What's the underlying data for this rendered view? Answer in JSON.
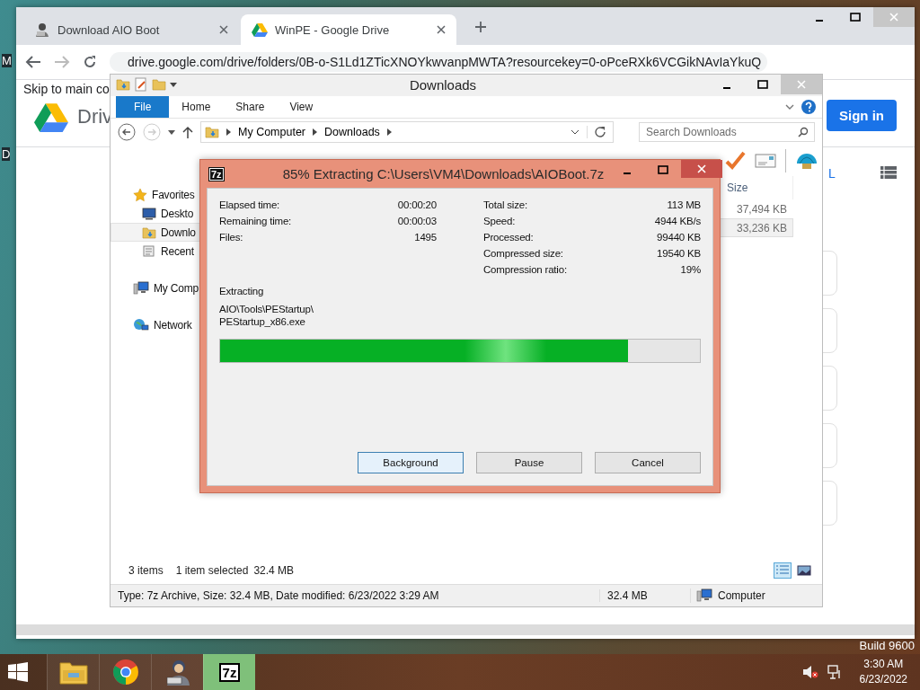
{
  "desktop": {
    "labels": [
      "M",
      "D"
    ],
    "build_label": "Build 9600"
  },
  "browser": {
    "tabs": [
      {
        "title": "Download AIO Boot",
        "kind": "avatar",
        "selected": false
      },
      {
        "title": "WinPE - Google Drive",
        "kind": "drive",
        "selected": true
      }
    ],
    "url": "drive.google.com/drive/folders/0B-o-S1Ld1ZTicXNOYkwvanpMWTA?resourcekey=0-oPceRXk6VCGikNAvIaYkuQ",
    "skip_link": "Skip to main co",
    "app_name": "Driv",
    "sign_in": "Sign in",
    "column_text": "L"
  },
  "explorer": {
    "title": "Downloads",
    "ribbon_tabs": [
      {
        "label": "File",
        "selected": true
      },
      {
        "label": "Home",
        "selected": false
      },
      {
        "label": "Share",
        "selected": false
      },
      {
        "label": "View",
        "selected": false
      }
    ],
    "breadcrumb": [
      "My Computer",
      "Downloads"
    ],
    "search": {
      "placeholder": "Search Downloads"
    },
    "nav": [
      {
        "label": "Favorites",
        "kind": "star",
        "selected": false,
        "children": [
          {
            "label": "Deskto",
            "kind": "desktop",
            "selected": false
          },
          {
            "label": "Downlo",
            "kind": "downloads",
            "selected": true
          },
          {
            "label": "Recent",
            "kind": "recent",
            "selected": false
          }
        ]
      },
      {
        "label": "My Comp",
        "kind": "computer",
        "selected": false
      },
      {
        "label": "Network",
        "kind": "network",
        "selected": false
      }
    ],
    "columns": [
      "Size"
    ],
    "rows": [
      {
        "size": "37,494 KB",
        "selected": false
      },
      {
        "size": "33,236 KB",
        "selected": true
      }
    ],
    "item_count": "3 items",
    "selection_count": "1 item selected",
    "selection_size": "32.4 MB",
    "views": [
      {
        "kind": "details",
        "selected": true
      },
      {
        "kind": "thumbnails",
        "selected": false
      }
    ],
    "status_bar": {
      "details": "Type: 7z Archive, Size: 32.4 MB, Date modified: 6/23/2022 3:29 AM",
      "size": "32.4 MB",
      "location": "Computer"
    }
  },
  "dialog": {
    "icon_text": "7z",
    "title": "85% Extracting C:\\Users\\VM4\\Downloads\\AIOBoot.7z",
    "left_stats": [
      {
        "label": "Elapsed time:",
        "value": "00:00:20"
      },
      {
        "label": "Remaining time:",
        "value": "00:00:03"
      },
      {
        "label": "Files:",
        "value": "1495"
      }
    ],
    "right_stats": [
      {
        "label": "Total size:",
        "value": "113 MB"
      },
      {
        "label": "Speed:",
        "value": "4944 KB/s"
      },
      {
        "label": "Processed:",
        "value": "99440 KB"
      },
      {
        "label": "Compressed size:",
        "value": "19540 KB"
      },
      {
        "label": "Compression ratio:",
        "value": "19%"
      }
    ],
    "status": "Extracting",
    "path_lines": [
      "AIO\\Tools\\PEStartup\\",
      "PEStartup_x86.exe"
    ],
    "progress": {
      "level": 0.85
    },
    "buttons": [
      {
        "label": "Background",
        "focused": true
      },
      {
        "label": "Pause",
        "focused": false
      },
      {
        "label": "Cancel",
        "focused": false
      }
    ]
  },
  "taskbar": {
    "apps": [
      {
        "kind": "explorer",
        "active": false
      },
      {
        "kind": "chrome",
        "active": false
      },
      {
        "kind": "avatar",
        "active": false
      },
      {
        "kind": "sevenzip",
        "label": "7z",
        "active": true
      }
    ],
    "time": "3:30 AM",
    "date": "6/23/2022"
  }
}
